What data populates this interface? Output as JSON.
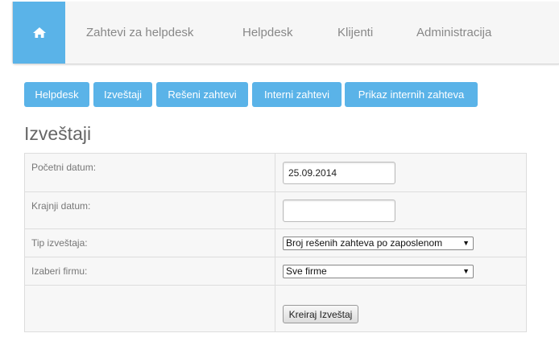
{
  "nav": {
    "home_icon": "home-icon",
    "items": [
      "Zahtevi za helpdesk",
      "Helpdesk",
      "Klijenti",
      "Administracija"
    ]
  },
  "toolbar": {
    "buttons": [
      "Helpdesk",
      "Izveštaji",
      "Rešeni zahtevi",
      "Interni zahtevi",
      "Prikaz internih zahteva"
    ]
  },
  "page": {
    "title": "Izveštaji"
  },
  "form": {
    "start_date": {
      "label": "Početni datum:",
      "value": "25.09.2014"
    },
    "end_date": {
      "label": "Krajnji datum:",
      "value": ""
    },
    "report_type": {
      "label": "Tip izveštaja:",
      "selected": "Broj rešenih zahteva po zaposlenom"
    },
    "company": {
      "label": "Izaberi firmu:",
      "selected": "Sve firme"
    },
    "submit_label": "Kreiraj Izveštaj"
  },
  "colors": {
    "accent": "#5ab3e8",
    "nav_background": "#f6f6f6",
    "table_background": "#f7f7f7"
  }
}
